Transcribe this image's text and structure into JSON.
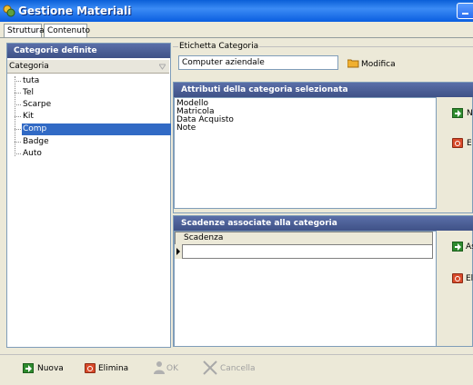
{
  "window": {
    "title": "Gestione Materiali"
  },
  "tabs": [
    {
      "label": "Struttura",
      "active": true
    },
    {
      "label": "Contenuto",
      "active": false
    }
  ],
  "categories_panel": {
    "header": "Categorie definite",
    "column_header": "Categoria",
    "items": [
      "tuta",
      "Tel",
      "Scarpe",
      "Kit",
      "Comp",
      "Badge",
      "Auto"
    ],
    "selected": "Comp"
  },
  "label_group": {
    "title": "Etichetta Categoria",
    "value": "Computer aziendale",
    "modify_label": "Modifica"
  },
  "attributes_section": {
    "header": "Attributi della categoria selezionata",
    "items": [
      "Modello",
      "Matricola",
      "Data Acquisto",
      "Note"
    ],
    "new_label": "N",
    "delete_label": "E"
  },
  "deadlines_section": {
    "header": "Scadenze associate alla categoria",
    "column_header": "Scadenza",
    "add_label": "As",
    "delete_label": "El"
  },
  "bottom_bar": {
    "new_label": "Nuova",
    "delete_label": "Elimina",
    "ok_label": "OK",
    "cancel_label": "Cancella"
  },
  "colors": {
    "title_bar": "#0a5fd8",
    "selection": "#316ac5",
    "panel_header": "#4a5d96"
  }
}
